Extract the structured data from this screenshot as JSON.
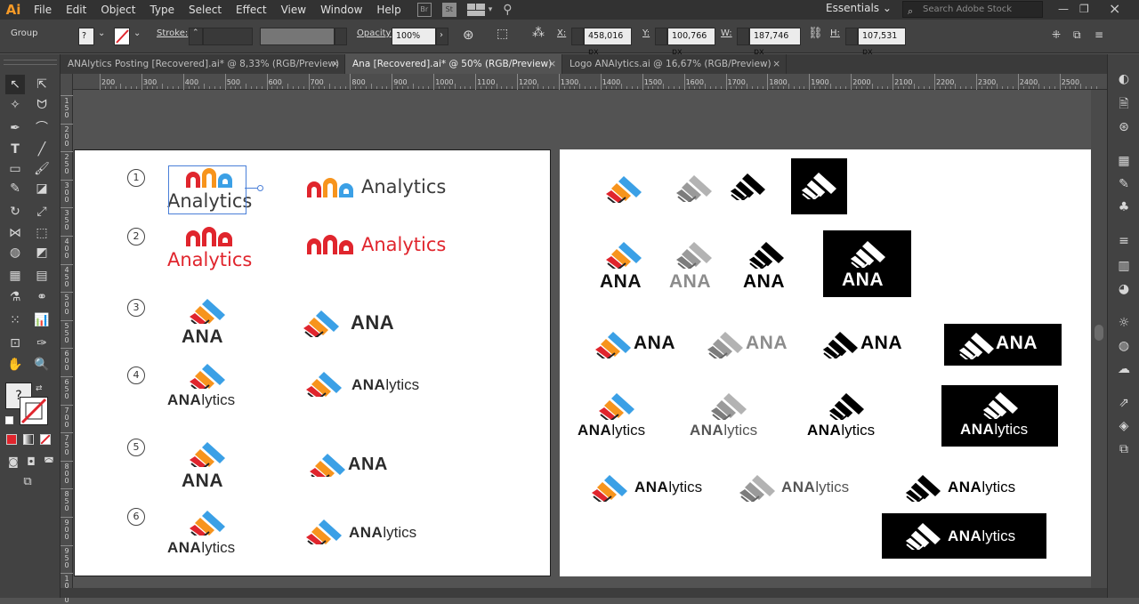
{
  "app": {
    "logo": "Ai"
  },
  "menu": [
    "File",
    "Edit",
    "Object",
    "Type",
    "Select",
    "Effect",
    "View",
    "Window",
    "Help"
  ],
  "menubar_icons": {
    "bridge": "Br",
    "stock": "St"
  },
  "workspace": "Essentials",
  "search_placeholder": "Search Adobe Stock",
  "control": {
    "selection_type": "Group",
    "fill_question": "?",
    "stroke_label": "Stroke:",
    "opacity_label": "Opacity:",
    "opacity_value": "100%",
    "x_label": "X:",
    "x_value": "458,016 px",
    "y_label": "Y:",
    "y_value": "100,766 px",
    "w_label": "W:",
    "w_value": "187,746 px",
    "h_label": "H:",
    "h_value": "107,531 px"
  },
  "tabs": [
    {
      "label": "ANAlytics Posting [Recovered].ai* @ 8,33% (RGB/Preview)",
      "active": false
    },
    {
      "label": "Ana [Recovered].ai* @ 50% (RGB/Preview)",
      "active": true
    },
    {
      "label": "Logo ANAlytics.ai @ 16,67% (RGB/Preview)",
      "active": false
    }
  ],
  "tab_close": "×",
  "ruler_top": [
    "200",
    "300",
    "400",
    "500",
    "600",
    "700",
    "800",
    "900",
    "1000",
    "1100",
    "1200",
    "1300",
    "1400",
    "1500",
    "1600",
    "1700",
    "1800",
    "1900",
    "2000",
    "2100",
    "2200",
    "2300",
    "2400",
    "2500"
  ],
  "ruler_left": [
    "1\n5\n0",
    "2\n0\n0",
    "2\n5\n0",
    "3\n0\n0",
    "3\n5\n0",
    "4\n0\n0",
    "4\n5\n0",
    "5\n0\n0",
    "5\n5\n0",
    "6\n0\n0",
    "6\n5\n0",
    "7\n0\n0",
    "7\n5\n0",
    "8\n0\n0",
    "8\n5\n0",
    "9\n0\n0",
    "9\n5\n0",
    "1\n0\n0\n0"
  ],
  "artboard1": {
    "numbers": [
      "1",
      "2",
      "3",
      "4",
      "5",
      "6"
    ],
    "row1_left_text": "Analytics",
    "row1_right_text": "Analytics",
    "row2_left_text": "Analytics",
    "row2_right_text": "Analytics",
    "ana": "ANA",
    "lytics": "lytics"
  },
  "artboard2": {
    "ana": "ANA",
    "lytics": "lytics"
  },
  "colors": {
    "brand_red": "#e0252d",
    "brand_orange": "#f7941d",
    "brand_blue": "#3ba0e6",
    "gray_mark": "#8c8c8c",
    "accent_ui": "#f79a27"
  },
  "toolbox_question": "?"
}
